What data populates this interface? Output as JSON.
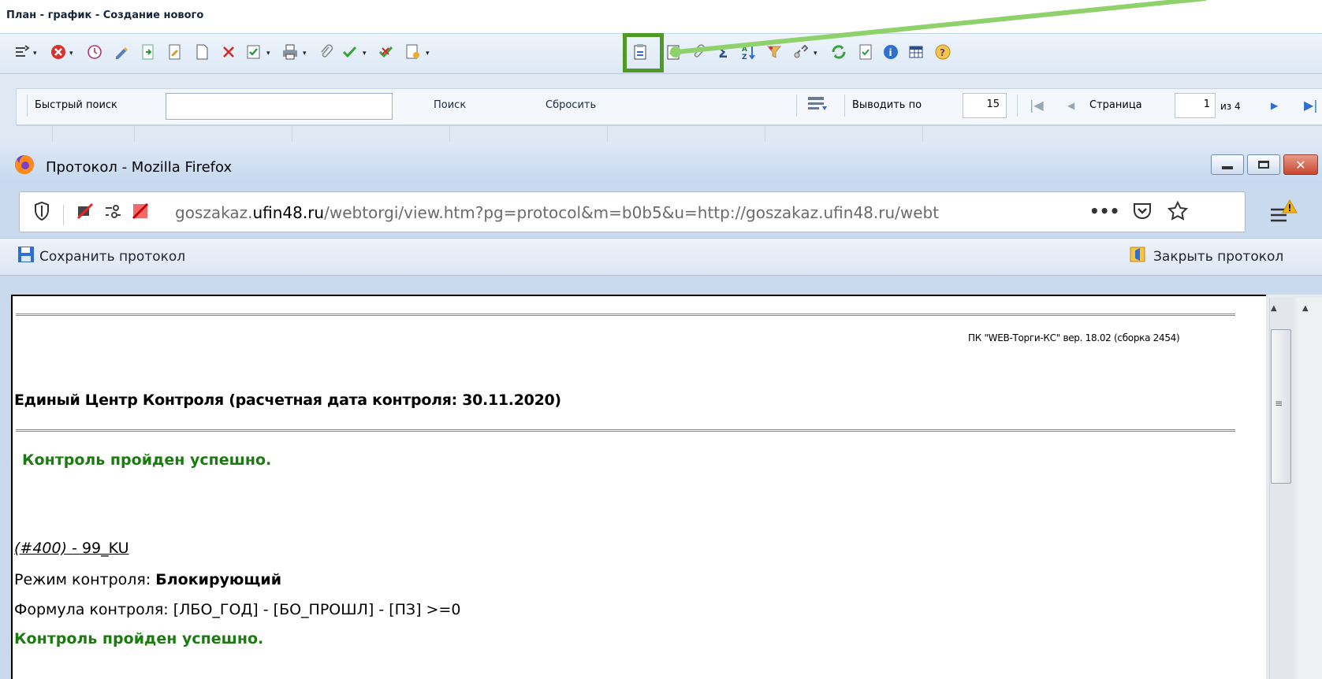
{
  "app": {
    "title": "План - график - Создание нового",
    "search": {
      "quick_label": "Быстрый поиск",
      "quick_value": "",
      "search_btn": "Поиск",
      "reset_btn": "Сбросить",
      "per_page_label": "Выводить по",
      "per_page_value": "15",
      "page_label": "Страница",
      "page_value": "1",
      "of_label": "из 4"
    },
    "highlight_color": "#4f9a24"
  },
  "firefox": {
    "title": "Протокол - Mozilla Firefox",
    "url_prefix": "goszakaz.",
    "url_domain": "ufin48.ru",
    "url_rest": "/webtorgi/view.htm?pg=protocol&m=b0b5&u=http://goszakaz.ufin48.ru/webt",
    "more": "•••",
    "save_protocol": "Сохранить протокол",
    "close_protocol": "Закрыть протокол"
  },
  "document": {
    "version": "ПК \"WEB-Торги-КС\" вер. 18.02 (сборка 2454)",
    "center_title": "Единый Центр Контроля (расчетная дата контроля: 30.11.2020)",
    "ok_message": "Контроль пройден успешно.",
    "rule_id_link": "(#400)",
    "rule_id_rest": " - 99_KU",
    "mode_label": "Режим контроля: ",
    "mode_value": "Блокирующий",
    "formula": "Формула контроля: [ЛБО_ГОД] - [БО_ПРОШЛ] - [ПЗ] >=0",
    "ok_message_2": "Контроль пройден успешно."
  },
  "colors": {
    "ok_green": "#1b7a10",
    "accent_blue": "#2f6fd0"
  }
}
